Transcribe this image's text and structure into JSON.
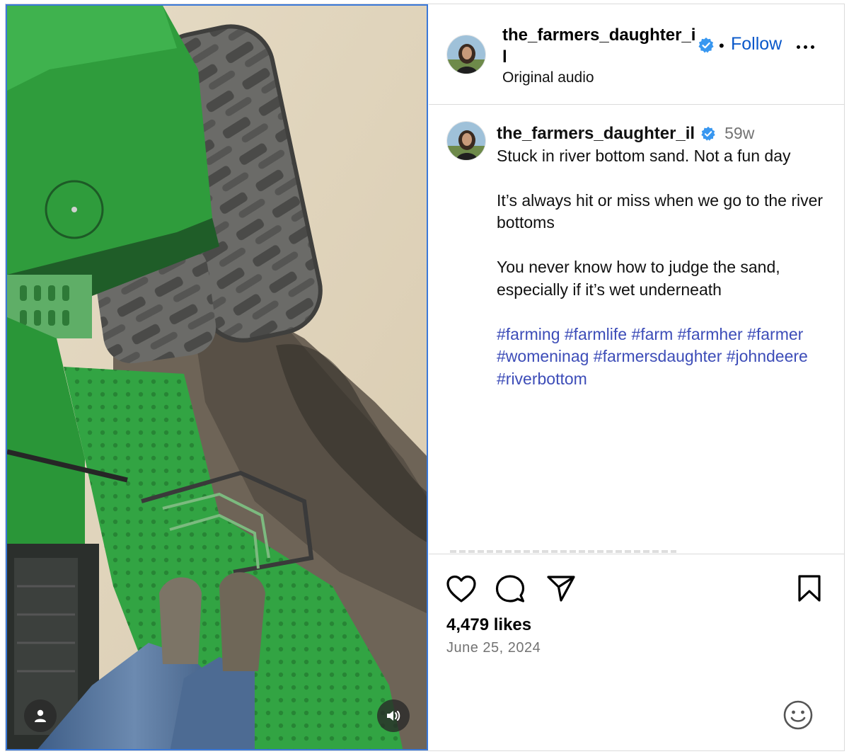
{
  "post": {
    "media": {
      "user_tag_icon": "user-icon",
      "audio_icon": "speaker-icon"
    },
    "header": {
      "username": "the_farmers_daughter_il",
      "follow_label": "Follow",
      "separator": "•",
      "subtitle": "Original audio"
    },
    "caption": {
      "username": "the_farmers_daughter_il",
      "time": "59w",
      "paragraphs": [
        "Stuck in river bottom sand. Not a fun day",
        "It’s always hit or miss when we go to the river bottoms",
        "You never know how to judge the sand, especially if it’s wet underneath"
      ],
      "hashtags": "#farming #farmlife #farm #farmher #farmer #womeninag #farmersdaughter #johndeere #riverbottom"
    },
    "actions": {
      "likes": "4,479 likes",
      "date": "June 25, 2024"
    },
    "colors": {
      "link_blue": "#0a58ca",
      "hashtag_blue": "#3d4db8",
      "verified_blue": "#3897f0",
      "tractor_green": "#2e9e3e"
    }
  }
}
